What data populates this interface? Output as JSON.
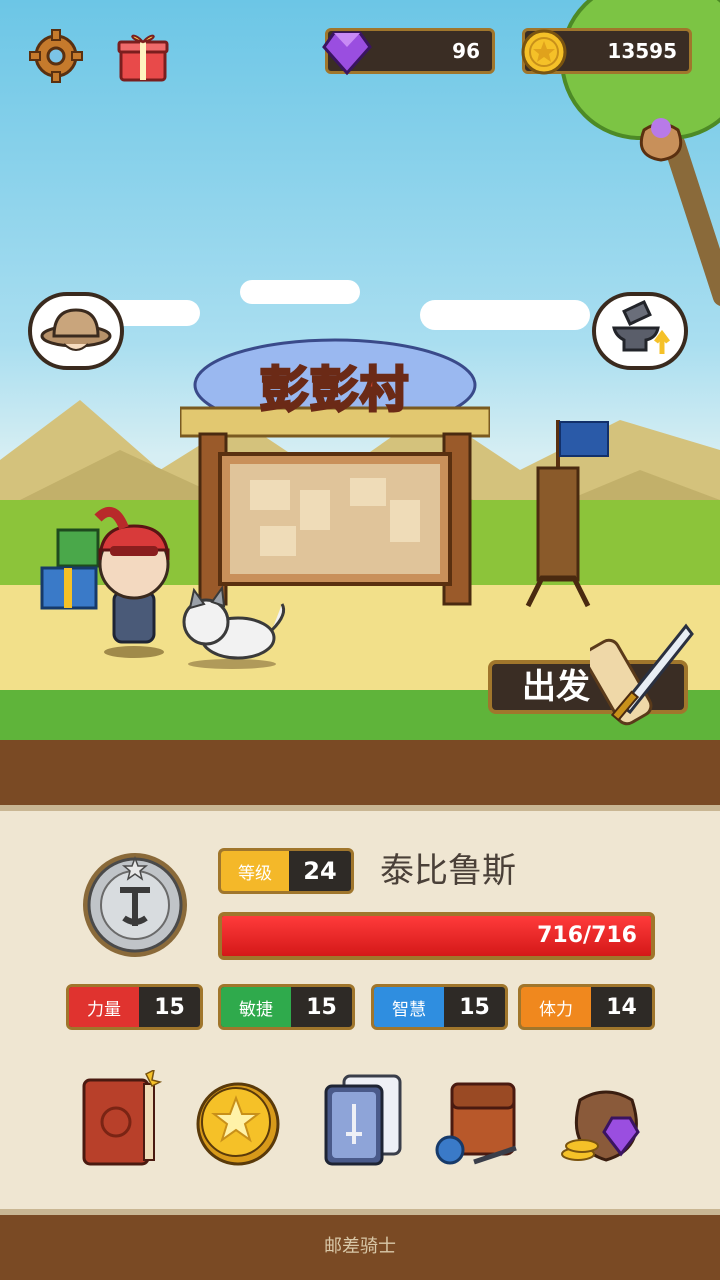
{
  "resources": {
    "gems": "96",
    "gold": "13595"
  },
  "village": {
    "sign_text": "彭彭村"
  },
  "actions": {
    "start_label": "出发"
  },
  "hero": {
    "level_label": "等级",
    "level": "24",
    "name": "泰比鲁斯",
    "hp_text": "716/716",
    "hp_fraction": 1.0
  },
  "stats": [
    {
      "label": "力量",
      "value": "15",
      "color": "#e0332f"
    },
    {
      "label": "敏捷",
      "value": "15",
      "color": "#2faa4c"
    },
    {
      "label": "智慧",
      "value": "15",
      "color": "#2f8ee0"
    },
    {
      "label": "体力",
      "value": "14",
      "color": "#f0881e"
    }
  ],
  "menu": [
    {
      "icon": "journal-book-icon"
    },
    {
      "icon": "star-coin-icon"
    },
    {
      "icon": "cards-icon"
    },
    {
      "icon": "backpack-icon"
    },
    {
      "icon": "treasure-bag-icon"
    }
  ],
  "footer": {
    "game_title": "邮差骑士"
  },
  "colors": {
    "accent": "#a0762c",
    "hp": "#e02020",
    "panel": "#efe6d2"
  }
}
